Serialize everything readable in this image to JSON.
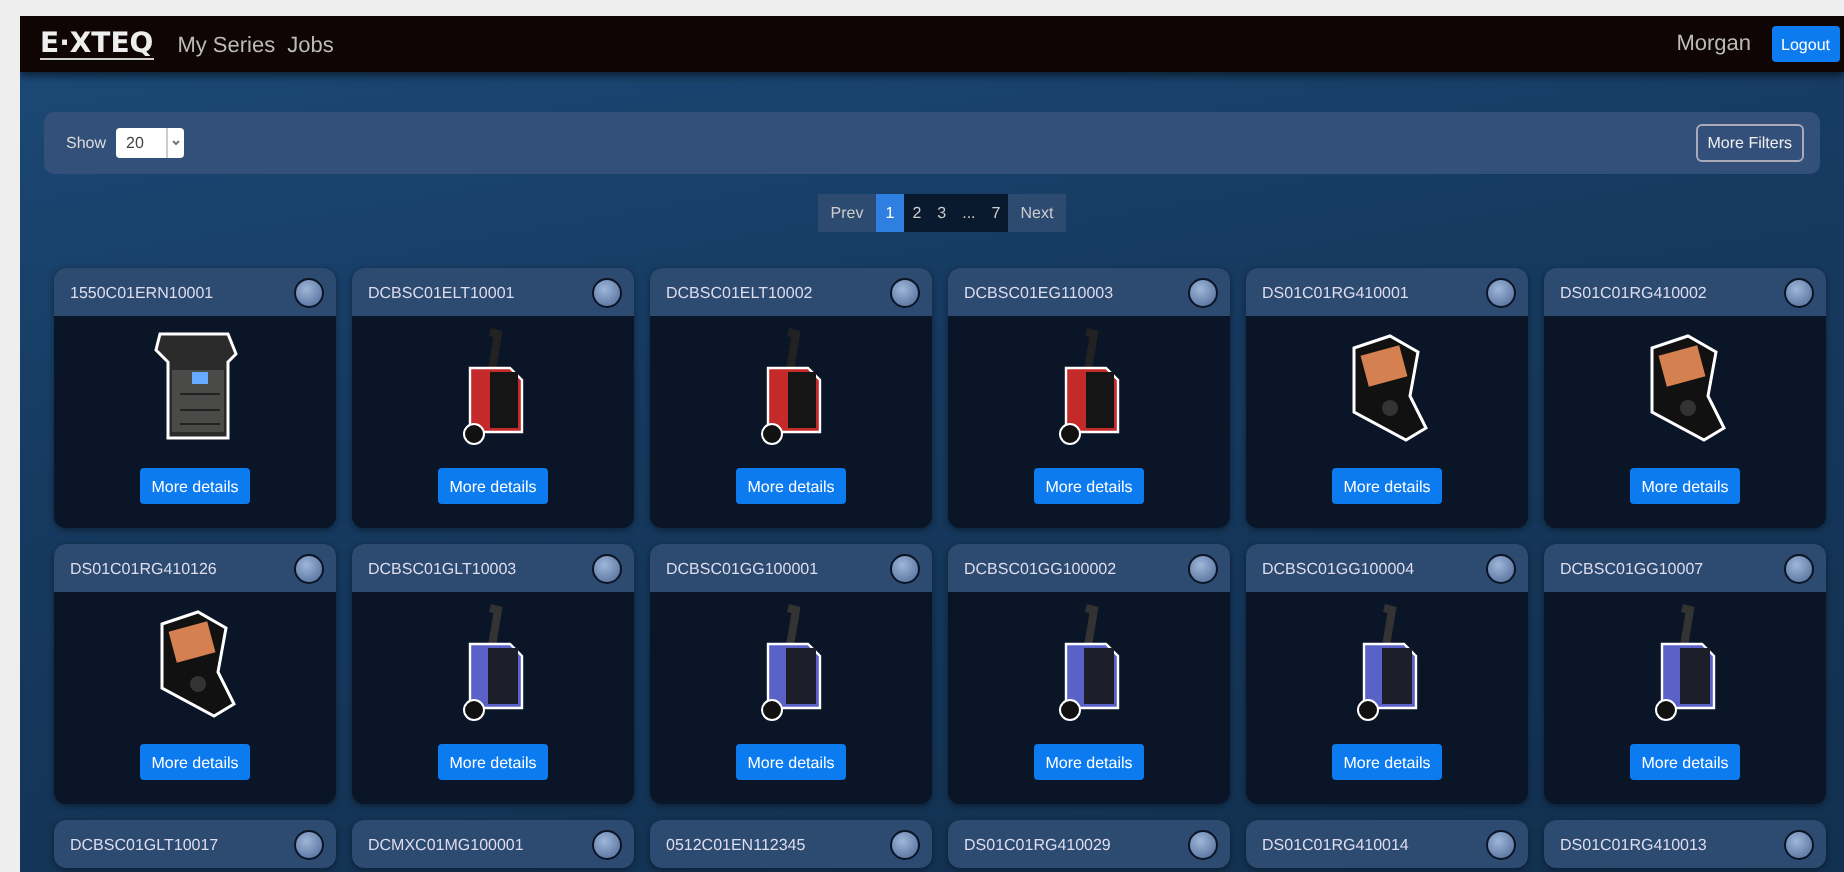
{
  "navbar": {
    "logo": "E·XTEQ",
    "links": [
      "My Series",
      "Jobs"
    ],
    "user": "Morgan",
    "logout": "Logout"
  },
  "filters": {
    "show_label": "Show",
    "page_size": "20",
    "more_filters": "More Filters"
  },
  "pagination": {
    "prev": "Prev",
    "next": "Next",
    "pages": [
      {
        "label": "1",
        "selected": true
      },
      {
        "label": "2",
        "selected": false
      },
      {
        "label": "3",
        "selected": false
      },
      {
        "label": "...",
        "selected": false
      },
      {
        "label": "7",
        "selected": false
      }
    ]
  },
  "cards": [
    {
      "serial": "1550C01ERN10001",
      "kind": "cabinet",
      "button": "More details"
    },
    {
      "serial": "DCBSC01ELT10001",
      "kind": "red-cart",
      "button": "More details"
    },
    {
      "serial": "DCBSC01ELT10002",
      "kind": "red-cart",
      "button": "More details"
    },
    {
      "serial": "DCBSC01EG110003",
      "kind": "red-cart",
      "button": "More details"
    },
    {
      "serial": "DS01C01RG410001",
      "kind": "handheld",
      "button": "More details"
    },
    {
      "serial": "DS01C01RG410002",
      "kind": "handheld",
      "button": "More details"
    },
    {
      "serial": "DS01C01RG410126",
      "kind": "handheld",
      "button": "More details"
    },
    {
      "serial": "DCBSC01GLT10003",
      "kind": "blue-cart",
      "button": "More details"
    },
    {
      "serial": "DCBSC01GG100001",
      "kind": "blue-cart",
      "button": "More details"
    },
    {
      "serial": "DCBSC01GG100002",
      "kind": "blue-cart",
      "button": "More details"
    },
    {
      "serial": "DCBSC01GG100004",
      "kind": "blue-cart",
      "button": "More details"
    },
    {
      "serial": "DCBSC01GG10007",
      "kind": "blue-cart",
      "button": "More details"
    },
    {
      "serial": "DCBSC01GLT10017"
    },
    {
      "serial": "DCMXC01MG100001"
    },
    {
      "serial": "0512C01EN112345"
    },
    {
      "serial": "DS01C01RG410029"
    },
    {
      "serial": "DS01C01RG410014"
    },
    {
      "serial": "DS01C01RG410013"
    }
  ]
}
